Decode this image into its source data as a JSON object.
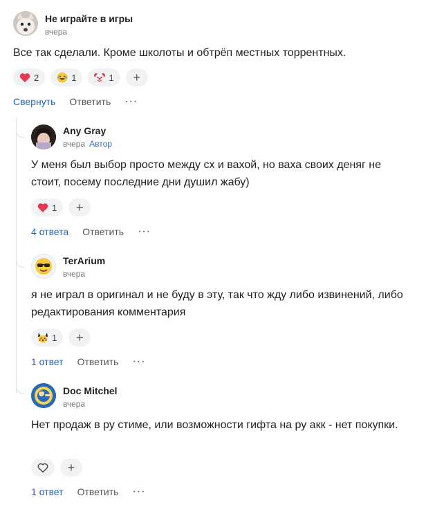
{
  "colors": {
    "link": "#1c63c2",
    "pill": "#f1f2f4",
    "thread": "#dfe1e5"
  },
  "top": {
    "author": "Не играйте в игры",
    "time": "вчера",
    "text": "Все так сделали. Кроме школоты и обтрёп местных торрентных.",
    "reactions": [
      {
        "icon": "heart-icon",
        "count": "2"
      },
      {
        "icon": "laughing-emoji-icon",
        "count": "1"
      },
      {
        "icon": "clown-emoji-icon",
        "count": "1"
      }
    ],
    "collapse_label": "Свернуть",
    "reply_label": "Ответить",
    "more_label": "···"
  },
  "replies": [
    {
      "author": "Any Gray",
      "time": "вчера",
      "badge": "Автор",
      "text": "У меня был выбор просто между сх и вахой, но ваха своих деняг не стоит, посему последние дни душил жабу)",
      "reaction": {
        "icon": "heart-icon",
        "count": "1"
      },
      "replies_label": "4 ответа",
      "reply_label": "Ответить",
      "more_label": "···"
    },
    {
      "author": "TerArium",
      "time": "вчера",
      "text": "я не играл в оригинал и не буду в эту, так что жду либо извинений, либо редактирования комментария",
      "reaction": {
        "icon": "pikachu-emoji-icon",
        "count": "1"
      },
      "replies_label": "1 ответ",
      "reply_label": "Ответить",
      "more_label": "···"
    },
    {
      "author": "Doc Mitchel",
      "time": "вчера",
      "text": "Нет продаж в ру стиме, или возможности гифта на ру акк - нет покупки.",
      "replies_label": "1 ответ",
      "reply_label": "Ответить",
      "more_label": "···"
    }
  ]
}
